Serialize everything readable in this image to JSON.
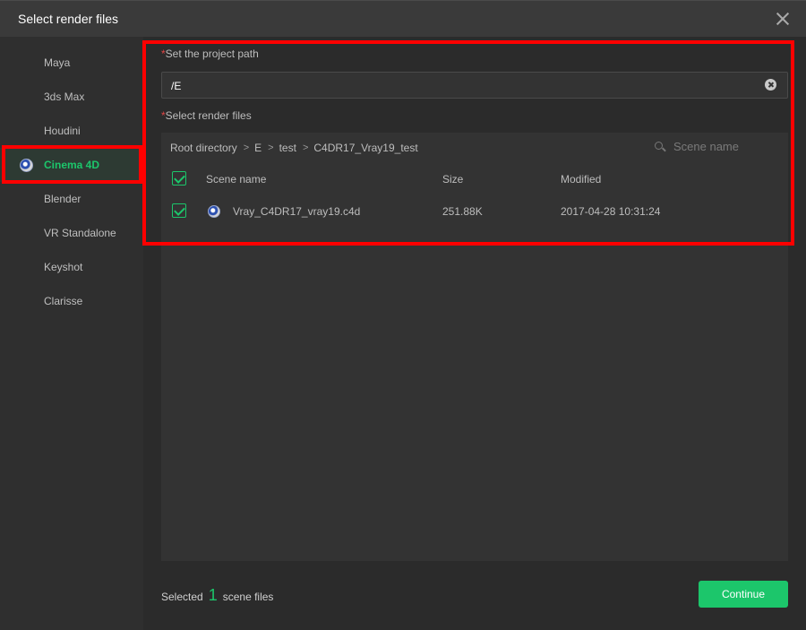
{
  "dialog": {
    "title": "Select render files"
  },
  "sidebar": {
    "items": [
      {
        "label": "Maya"
      },
      {
        "label": "3ds Max"
      },
      {
        "label": "Houdini"
      },
      {
        "label": "Cinema 4D",
        "active": true
      },
      {
        "label": "Blender"
      },
      {
        "label": "VR Standalone"
      },
      {
        "label": "Keyshot"
      },
      {
        "label": "Clarisse"
      }
    ]
  },
  "project": {
    "label": "Set the project path",
    "required_mark": "*",
    "path_value": "/E"
  },
  "render_files": {
    "label": "Select render files",
    "required_mark": "*",
    "breadcrumb": [
      "Root directory",
      "E",
      "test",
      "C4DR17_Vray19_test"
    ],
    "search_placeholder": "Scene name",
    "columns": {
      "name": "Scene name",
      "size": "Size",
      "modified": "Modified"
    },
    "rows": [
      {
        "name": "Vray_C4DR17_vray19.c4d",
        "size": "251.88K",
        "modified": "2017-04-28 10:31:24",
        "checked": true
      }
    ]
  },
  "footer": {
    "selected_prefix": "Selected",
    "selected_count": "1",
    "selected_suffix": "scene files",
    "continue_label": "Continue"
  },
  "colors": {
    "accent": "#1cc66b",
    "highlight_box": "#ff0000",
    "required": "#e04545"
  }
}
